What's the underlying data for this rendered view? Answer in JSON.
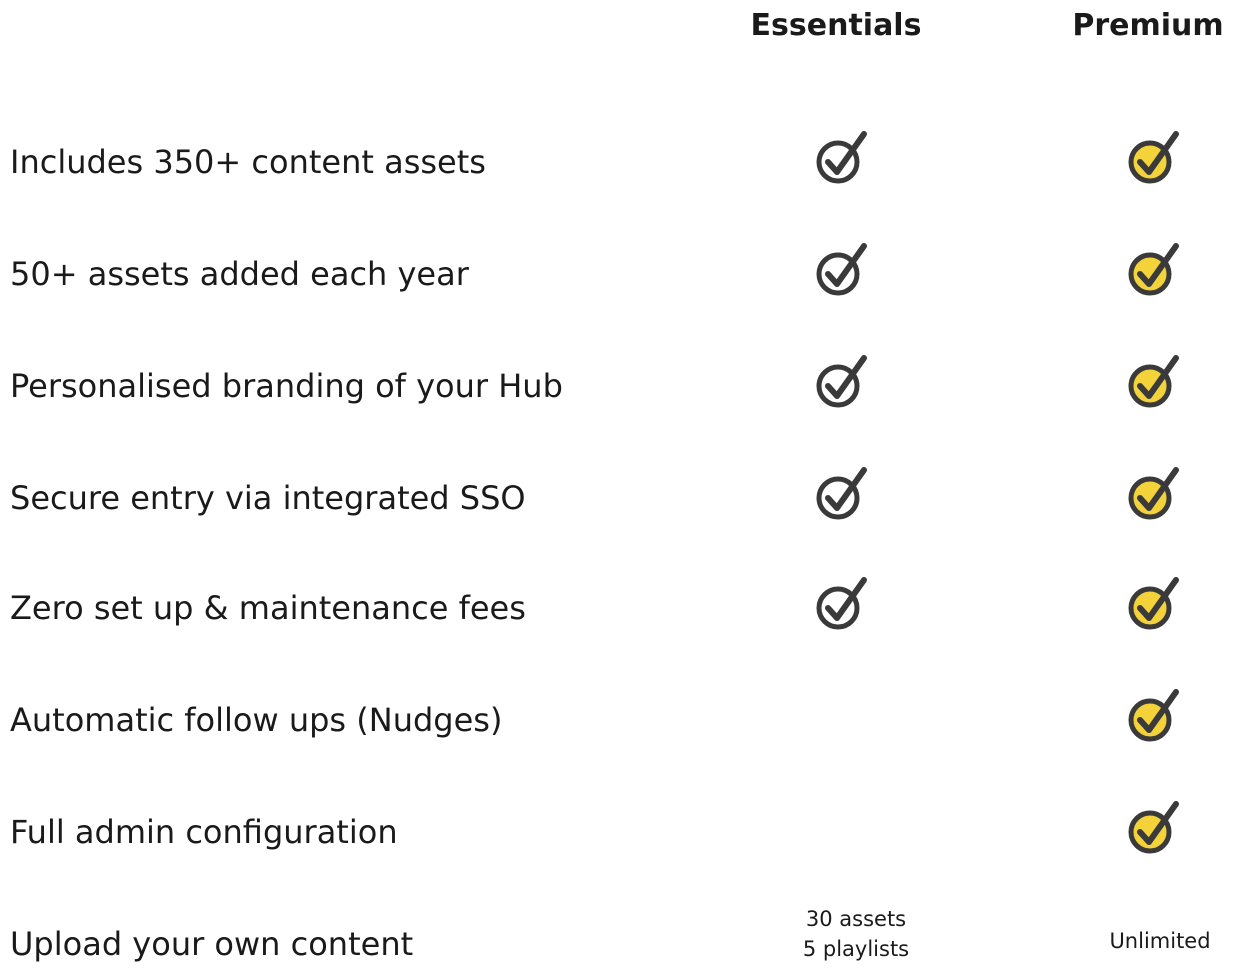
{
  "columns": {
    "essentials": "Essentials",
    "premium": "Premium"
  },
  "colors": {
    "text": "#1a1a1a",
    "check_stroke": "#3a3a3a",
    "premium_fill": "#f4d23a"
  },
  "icons": {
    "essentials_check": "check-circle-outline-icon",
    "premium_check": "check-circle-yellow-icon"
  },
  "features": [
    {
      "label": "Includes 350+ content assets",
      "essentials": true,
      "premium": true
    },
    {
      "label": "50+ assets added each year",
      "essentials": true,
      "premium": true
    },
    {
      "label": "Personalised branding of your Hub",
      "essentials": true,
      "premium": true
    },
    {
      "label": "Secure entry via integrated SSO",
      "essentials": true,
      "premium": true
    },
    {
      "label": "Zero set up & maintenance fees",
      "essentials": true,
      "premium": true
    },
    {
      "label": "Automatic follow ups (Nudges)",
      "essentials": false,
      "premium": true
    },
    {
      "label": "Full admin configuration",
      "essentials": false,
      "premium": true
    },
    {
      "label": "Upload your own content",
      "essentials_text": [
        "30 assets",
        "5 playlists"
      ],
      "premium_text": "Unlimited"
    }
  ]
}
